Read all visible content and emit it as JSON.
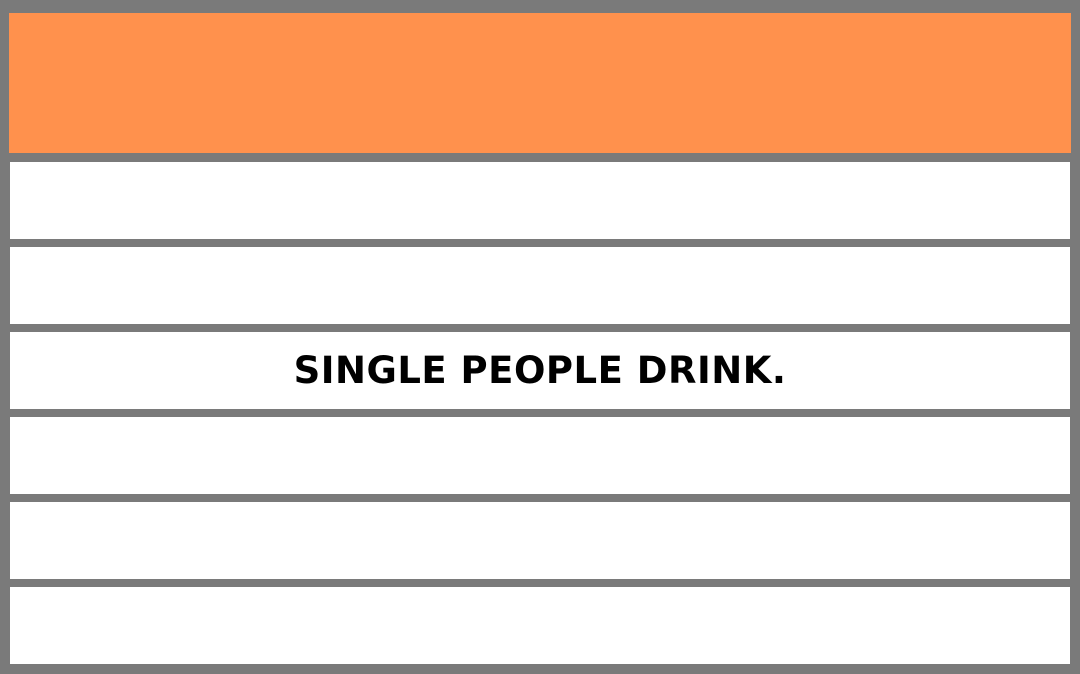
{
  "colors": {
    "frame": "#7a7a7a",
    "header": "#ff914d",
    "row": "#ffffff",
    "text": "#000000"
  },
  "rows": [
    {
      "text": ""
    },
    {
      "text": ""
    },
    {
      "text": "SINGLE PEOPLE DRINK."
    },
    {
      "text": ""
    },
    {
      "text": ""
    },
    {
      "text": ""
    }
  ]
}
